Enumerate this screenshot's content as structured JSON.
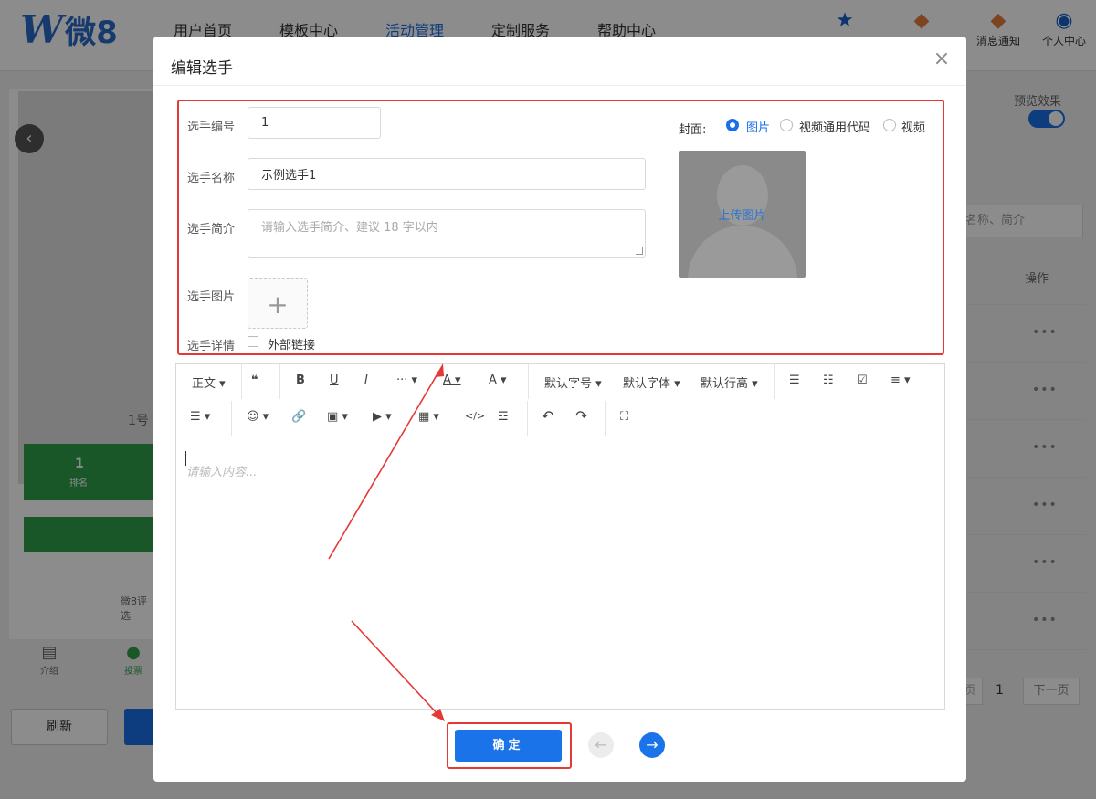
{
  "brand": {
    "logo_letter": "W",
    "logo_text": "微8"
  },
  "nav": {
    "links": [
      "用户首页",
      "模板中心",
      "活动管理",
      "定制服务",
      "帮助中心"
    ],
    "active_index": 2,
    "icons": [
      {
        "icon": "star-icon",
        "label": ""
      },
      {
        "icon": "medal-icon",
        "label": ""
      },
      {
        "icon": "medal-icon",
        "label": "消息通知"
      },
      {
        "icon": "user-icon",
        "label": "个人中心"
      }
    ]
  },
  "background": {
    "phone_name": "1号",
    "rank_value": "1",
    "rank_label": "排名",
    "footer_text": "微8评选",
    "tabs": [
      {
        "icon": "doc-icon",
        "label": "介绍"
      },
      {
        "icon": "person-icon",
        "label": "投票"
      }
    ],
    "refresh_label": "刷新",
    "preview_label": "预览效果",
    "search_placeholder": "名称、简介",
    "ops_header": "操作",
    "ops_dots": "•••",
    "pager_prev": "页",
    "pager_num": "1",
    "pager_next": "下一页"
  },
  "modal": {
    "title": "编辑选手",
    "close_icon": "close-icon",
    "fields": {
      "number_label": "选手编号",
      "number_value": "1",
      "name_label": "选手名称",
      "name_value": "示例选手1",
      "intro_label": "选手简介",
      "intro_placeholder": "请输入选手简介、建议 18 字以内",
      "image_label": "选手图片",
      "upload_plus": "+",
      "detail_label": "选手详情",
      "external_link_label": "外部链接"
    },
    "cover": {
      "label": "封面:",
      "options": [
        "图片",
        "视频通用代码",
        "视频"
      ],
      "selected": 0,
      "upload_text": "上传图片"
    },
    "editor": {
      "toolbar_row1": [
        "正文 ▾",
        "❝",
        "B",
        "U",
        "I",
        "··· ▾",
        "A ▾",
        "A ▾",
        "默认字号 ▾",
        "默认字体 ▾",
        "默认行高 ▾",
        "☰",
        "☷",
        "☑",
        "≡ ▾"
      ],
      "toolbar_row2": [
        "☰ ▾",
        "☺ ▾",
        "🔗",
        "▣ ▾",
        "▶ ▾",
        "▦ ▾",
        "</>",
        "☲",
        "↶",
        "↷",
        "⛶"
      ],
      "placeholder": "请输入内容..."
    },
    "confirm_label": "确定",
    "prev_icon": "←",
    "next_icon": "→"
  }
}
